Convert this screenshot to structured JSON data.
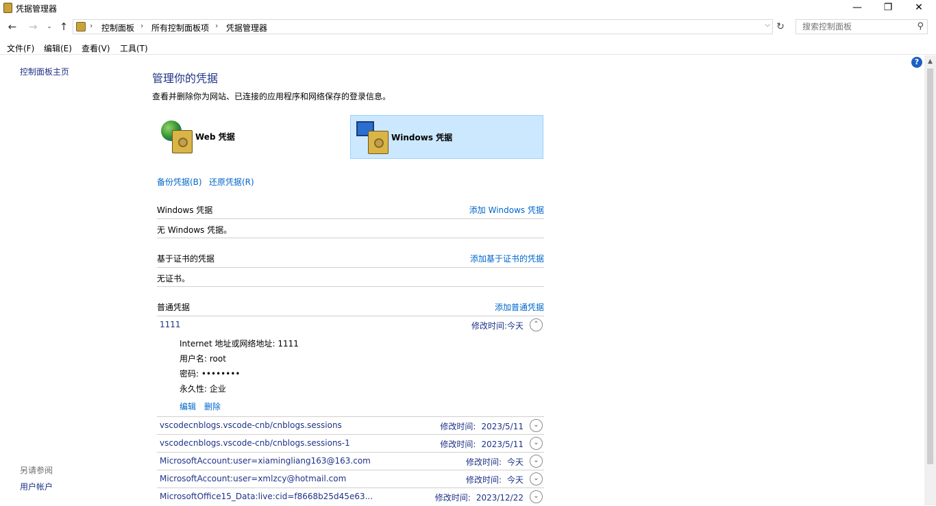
{
  "window": {
    "title": "凭据管理器",
    "min_icon": "minimize-icon",
    "max_icon": "restore-icon",
    "close_icon": "close-icon"
  },
  "address": {
    "crumbs": [
      "控制面板",
      "所有控制面板项",
      "凭据管理器"
    ],
    "search_placeholder": "搜索控制面板"
  },
  "menu": [
    "文件(F)",
    "编辑(E)",
    "查看(V)",
    "工具(T)"
  ],
  "left": {
    "home_link": "控制面板主页",
    "see_also_label": "另请参阅",
    "user_accounts_link": "用户帐户"
  },
  "main": {
    "heading": "管理你的凭据",
    "subtitle": "查看并删除你为网站、已连接的应用程序和网络保存的登录信息。",
    "web_tile": "Web 凭据",
    "windows_tile": "Windows 凭据",
    "backup_link": "备份凭据(B)",
    "restore_link": "还原凭据(R)",
    "windows_section": {
      "title": "Windows 凭据",
      "add": "添加 Windows 凭据",
      "empty": "无 Windows 凭据。"
    },
    "cert_section": {
      "title": "基于证书的凭据",
      "add": "添加基于证书的凭据",
      "empty": "无证书。"
    },
    "generic_section": {
      "title": "普通凭据",
      "add": "添加普通凭据"
    },
    "modified_label": "修改时间:",
    "expanded": {
      "name": "1111",
      "modified": "今天",
      "address_line": "Internet 地址或网络地址: 1111",
      "username_line": "用户名: root",
      "password_line": "密码: ••••••••",
      "persistence_line": "永久性: 企业",
      "edit": "编辑",
      "delete": "删除"
    },
    "credentials": [
      {
        "name": "vscodecnblogs.vscode-cnb/cnblogs.sessions",
        "modified": "2023/5/11"
      },
      {
        "name": "vscodecnblogs.vscode-cnb/cnblogs.sessions-1",
        "modified": "2023/5/11"
      },
      {
        "name": "MicrosoftAccount:user=xiamingliang163@163.com",
        "modified": "今天"
      },
      {
        "name": "MicrosoftAccount:user=xmlzcy@hotmail.com",
        "modified": "今天"
      },
      {
        "name": "MicrosoftOffice15_Data:live:cid=f8668b25d45e63...",
        "modified": "2023/12/22"
      }
    ]
  }
}
